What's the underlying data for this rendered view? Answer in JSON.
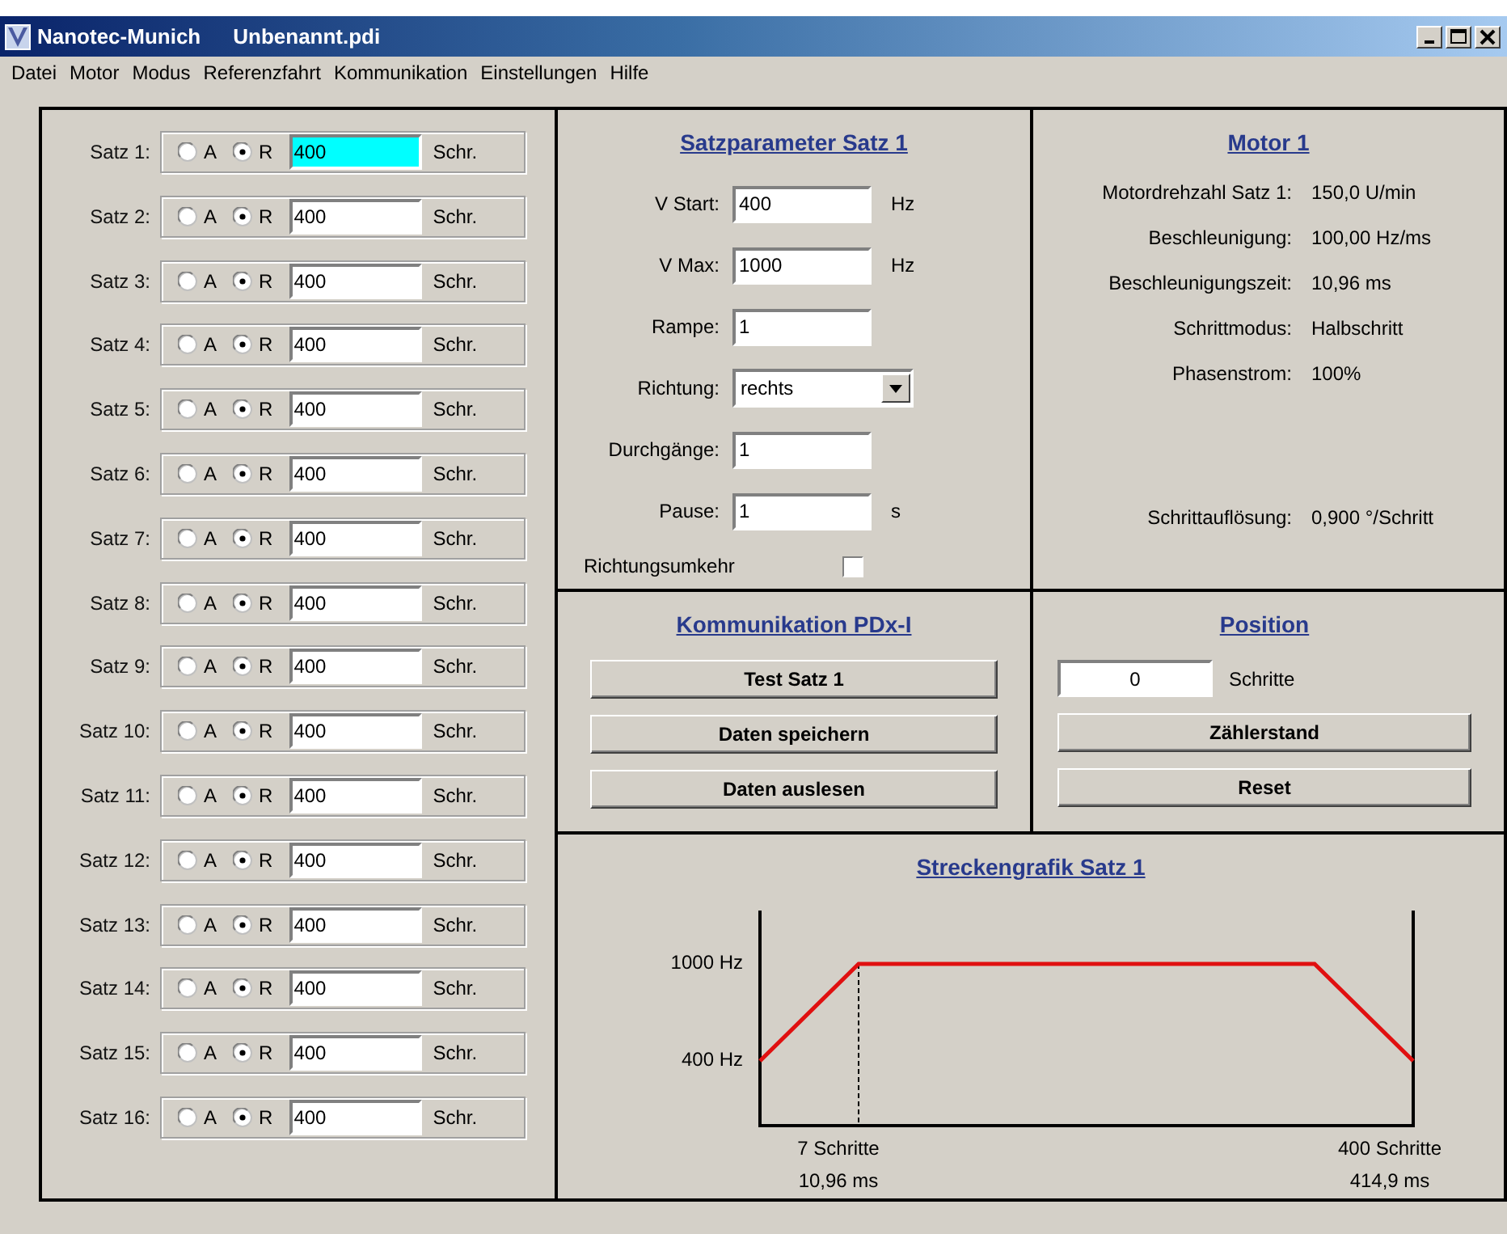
{
  "window": {
    "app": "Nanotec-Munich",
    "file": "Unbenannt.pdi"
  },
  "menu": [
    "Datei",
    "Motor",
    "Modus",
    "Referenzfahrt",
    "Kommunikation",
    "Einstellungen",
    "Hilfe"
  ],
  "saetze": [
    {
      "label": "Satz 1:",
      "options": [
        {
          "label": "A",
          "selected": false
        },
        {
          "label": "R",
          "selected": true
        }
      ],
      "value": "400",
      "focused": true,
      "unit": "Schr."
    },
    {
      "label": "Satz 2:",
      "options": [
        {
          "label": "A",
          "selected": false
        },
        {
          "label": "R",
          "selected": true
        }
      ],
      "value": "400",
      "focused": false,
      "unit": "Schr."
    },
    {
      "label": "Satz 3:",
      "options": [
        {
          "label": "A",
          "selected": false
        },
        {
          "label": "R",
          "selected": true
        }
      ],
      "value": "400",
      "focused": false,
      "unit": "Schr."
    },
    {
      "label": "Satz 4:",
      "options": [
        {
          "label": "A",
          "selected": false
        },
        {
          "label": "R",
          "selected": true
        }
      ],
      "value": "400",
      "focused": false,
      "unit": "Schr."
    },
    {
      "label": "Satz 5:",
      "options": [
        {
          "label": "A",
          "selected": false
        },
        {
          "label": "R",
          "selected": true
        }
      ],
      "value": "400",
      "focused": false,
      "unit": "Schr."
    },
    {
      "label": "Satz 6:",
      "options": [
        {
          "label": "A",
          "selected": false
        },
        {
          "label": "R",
          "selected": true
        }
      ],
      "value": "400",
      "focused": false,
      "unit": "Schr."
    },
    {
      "label": "Satz 7:",
      "options": [
        {
          "label": "A",
          "selected": false
        },
        {
          "label": "R",
          "selected": true
        }
      ],
      "value": "400",
      "focused": false,
      "unit": "Schr."
    },
    {
      "label": "Satz 8:",
      "options": [
        {
          "label": "A",
          "selected": false
        },
        {
          "label": "R",
          "selected": true
        }
      ],
      "value": "400",
      "focused": false,
      "unit": "Schr."
    },
    {
      "label": "Satz 9:",
      "options": [
        {
          "label": "A",
          "selected": false
        },
        {
          "label": "R",
          "selected": true
        }
      ],
      "value": "400",
      "focused": false,
      "unit": "Schr."
    },
    {
      "label": "Satz 10:",
      "options": [
        {
          "label": "A",
          "selected": false
        },
        {
          "label": "R",
          "selected": true
        }
      ],
      "value": "400",
      "focused": false,
      "unit": "Schr."
    },
    {
      "label": "Satz 11:",
      "options": [
        {
          "label": "A",
          "selected": false
        },
        {
          "label": "R",
          "selected": true
        }
      ],
      "value": "400",
      "focused": false,
      "unit": "Schr."
    },
    {
      "label": "Satz 12:",
      "options": [
        {
          "label": "A",
          "selected": false
        },
        {
          "label": "R",
          "selected": true
        }
      ],
      "value": "400",
      "focused": false,
      "unit": "Schr."
    },
    {
      "label": "Satz 13:",
      "options": [
        {
          "label": "A",
          "selected": false
        },
        {
          "label": "R",
          "selected": true
        }
      ],
      "value": "400",
      "focused": false,
      "unit": "Schr."
    },
    {
      "label": "Satz 14:",
      "options": [
        {
          "label": "A",
          "selected": false
        },
        {
          "label": "R",
          "selected": true
        }
      ],
      "value": "400",
      "focused": false,
      "unit": "Schr."
    },
    {
      "label": "Satz 15:",
      "options": [
        {
          "label": "A",
          "selected": false
        },
        {
          "label": "R",
          "selected": true
        }
      ],
      "value": "400",
      "focused": false,
      "unit": "Schr."
    },
    {
      "label": "Satz 16:",
      "options": [
        {
          "label": "A",
          "selected": false
        },
        {
          "label": "R",
          "selected": true
        }
      ],
      "value": "400",
      "focused": false,
      "unit": "Schr."
    }
  ],
  "satzparameter": {
    "title": "Satzparameter Satz 1",
    "fields": [
      {
        "kind": "text",
        "label": "V Start:",
        "value": "400",
        "unit": "Hz"
      },
      {
        "kind": "text",
        "label": "V Max:",
        "value": "1000",
        "unit": "Hz"
      },
      {
        "kind": "text",
        "label": "Rampe:",
        "value": "1"
      },
      {
        "kind": "select",
        "label": "Richtung:",
        "value": "rechts"
      },
      {
        "kind": "text",
        "label": "Durchgänge:",
        "value": "1"
      },
      {
        "kind": "text",
        "label": "Pause:",
        "value": "1",
        "unit": "s"
      },
      {
        "kind": "checkbox",
        "label": "Richtungsumkehr",
        "checked": false
      }
    ]
  },
  "motor": {
    "title": "Motor 1",
    "rows": [
      {
        "key": "Motordrehzahl Satz 1:",
        "value": "150,0 U/min"
      },
      {
        "key": "Beschleunigung:",
        "value": "100,00 Hz/ms"
      },
      {
        "key": "Beschleunigungszeit:",
        "value": "10,96 ms"
      },
      {
        "key": "Schrittmodus:",
        "value": "Halbschritt"
      },
      {
        "key": "Phasenstrom:",
        "value": "100%"
      }
    ],
    "footer": {
      "key": "Schrittauflösung:",
      "value": "0,900 °/Schritt"
    }
  },
  "kommunikation": {
    "title": "Kommunikation PDx-I",
    "buttons": [
      "Test Satz 1",
      "Daten speichern",
      "Daten auslesen"
    ]
  },
  "position": {
    "title": "Position",
    "value": "0",
    "unit": "Schritte",
    "buttons": [
      "Zählerstand",
      "Reset"
    ]
  },
  "streckengrafik": {
    "title": "Streckengrafik Satz 1",
    "y_labels": [
      "1000 Hz",
      "400 Hz"
    ],
    "x_labels": [
      {
        "steps": "7 Schritte",
        "time": "10,96 ms"
      },
      {
        "steps": "400 Schritte",
        "time": "414,9 ms"
      }
    ]
  }
}
